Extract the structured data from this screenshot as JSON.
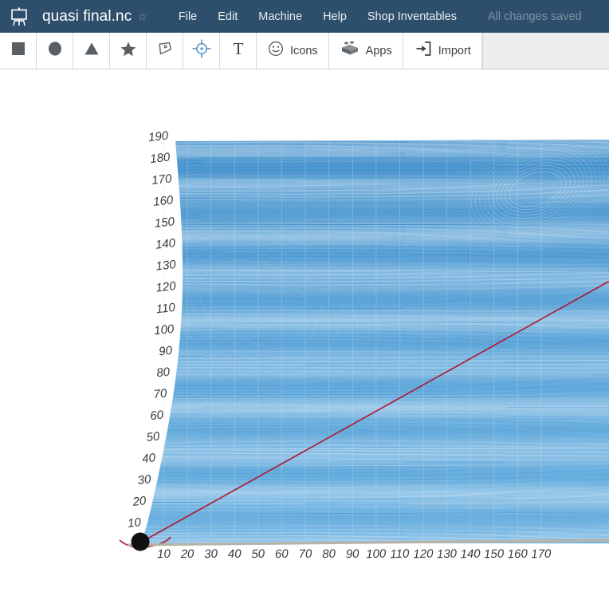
{
  "header": {
    "logo_icon": "easel-logo-icon",
    "document_title": "quasi final.nc",
    "favorite_icon": "star-outline-icon",
    "menu": [
      {
        "label": "File",
        "name": "menu-file"
      },
      {
        "label": "Edit",
        "name": "menu-edit"
      },
      {
        "label": "Machine",
        "name": "menu-machine"
      },
      {
        "label": "Help",
        "name": "menu-help"
      },
      {
        "label": "Shop Inventables",
        "name": "menu-shop-inventables"
      }
    ],
    "save_status": "All changes saved",
    "colors": {
      "bar_background": "#2e4f6b",
      "title_text": "#ffffff",
      "menu_text": "#e9eef2",
      "status_text": "#7d93a6"
    }
  },
  "toolbar": {
    "items": [
      {
        "label": "",
        "icon": "square-shape-icon",
        "name": "tool-square"
      },
      {
        "label": "",
        "icon": "circle-shape-icon",
        "name": "tool-circle"
      },
      {
        "label": "",
        "icon": "triangle-shape-icon",
        "name": "tool-triangle"
      },
      {
        "label": "",
        "icon": "star-shape-icon",
        "name": "tool-star"
      },
      {
        "label": "",
        "icon": "pen-path-icon",
        "name": "tool-pen"
      },
      {
        "label": "",
        "icon": "crosshair-target-icon",
        "name": "tool-crosshair"
      },
      {
        "label": "",
        "icon": "text-tool-icon",
        "name": "tool-text"
      },
      {
        "label": "Icons",
        "icon": "smiley-face-icon",
        "name": "tool-icons"
      },
      {
        "label": "Apps",
        "icon": "lego-brick-icon",
        "name": "tool-apps"
      },
      {
        "label": "Import",
        "icon": "import-arrow-icon",
        "name": "tool-import"
      }
    ],
    "colors": {
      "background": "#ffffff",
      "icon": "#5a5f63",
      "label": "#3c4043",
      "filler_background": "#ededed"
    }
  },
  "chart_data": {
    "type": "line",
    "title": "",
    "xlabel": "",
    "ylabel": "",
    "x_ticks": [
      10,
      20,
      30,
      40,
      50,
      60,
      70,
      80,
      90,
      100,
      110,
      120,
      130,
      140,
      150,
      160,
      170
    ],
    "y_ticks": [
      10,
      20,
      30,
      40,
      50,
      60,
      70,
      80,
      90,
      100,
      110,
      120,
      130,
      140,
      150,
      160,
      170,
      180,
      190
    ],
    "xlim": [
      0,
      175
    ],
    "ylim": [
      0,
      192
    ],
    "grid": true,
    "legend": null,
    "annotations": [
      {
        "name": "origin-marker",
        "type": "point",
        "x": 0,
        "y": 0,
        "color": "#111111",
        "label": ""
      },
      {
        "name": "rapid-travel-line",
        "type": "line",
        "from": [
          0,
          0
        ],
        "to": [
          175,
          120
        ],
        "color": "#b01530"
      }
    ],
    "series": [
      {
        "name": "raster-toolpath",
        "type": "dense-horizontal-raster",
        "color": "#2e86c8",
        "line_count": 430,
        "description": "Dense horizontal blue raster carve toolpath filling the model region"
      }
    ],
    "colors": {
      "toolpath": "#2e86c8",
      "toolpath_light": "#86c2e6",
      "travel": "#b01530",
      "axis": "#b6b2a8",
      "grid": "#cfd8e0",
      "tick_text": "#3a3a3a",
      "origin": "#111111"
    }
  }
}
